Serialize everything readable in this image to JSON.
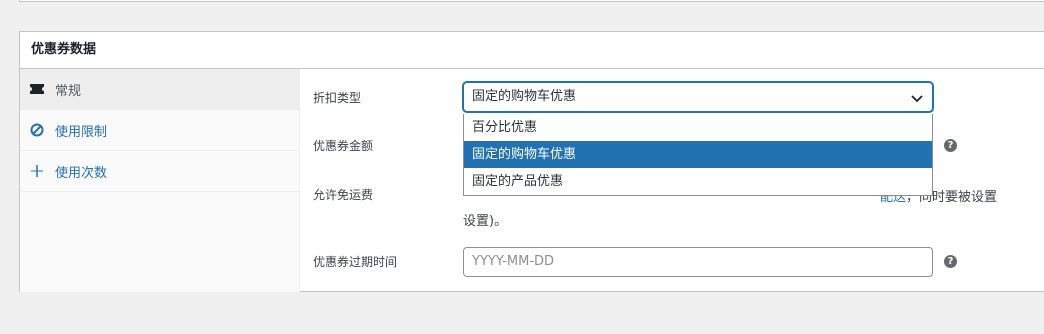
{
  "panel": {
    "title": "优惠券数据"
  },
  "tabs": [
    {
      "label": "常规",
      "icon": "ticket-icon"
    },
    {
      "label": "使用限制",
      "icon": "ban-icon"
    },
    {
      "label": "使用次数",
      "icon": "plus-icon"
    }
  ],
  "fields": {
    "discount_type": {
      "label": "折扣类型",
      "value": "固定的购物车优惠"
    },
    "amount": {
      "label": "优惠券金额"
    },
    "free_shipping": {
      "label": "允许免运费",
      "desc_tail_link": "配送",
      "desc_tail": "，同时要被设置",
      "desc_line2": "设置)。"
    },
    "expiry": {
      "label": "优惠券过期时间",
      "placeholder": "YYYY-MM-DD"
    }
  },
  "dropdown": {
    "options": [
      "百分比优惠",
      "固定的购物车优惠",
      "固定的产品优惠"
    ],
    "selected_index": 1
  },
  "help_glyph": "?",
  "colors": {
    "accent": "#2271b1",
    "border": "#c3c4c7",
    "background": "#f0f0f1"
  }
}
